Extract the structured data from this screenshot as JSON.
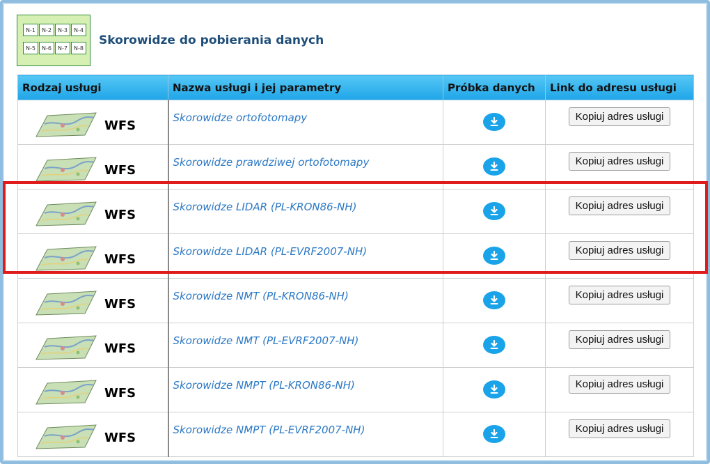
{
  "header": {
    "title": "Skorowidze do pobierania danych",
    "icon_cells": [
      "N-1",
      "N-2",
      "N-3",
      "N-4",
      "N-5",
      "N-6",
      "N-7",
      "N-8"
    ]
  },
  "table": {
    "columns": [
      "Rodzaj usługi",
      "Nazwa usługi i jej parametry",
      "Próbka danych",
      "Link do adresu usługi"
    ],
    "rows": [
      {
        "type": "WFS",
        "name": "Skorowidze ortofotomapy",
        "copy": "Kopiuj adres usługi"
      },
      {
        "type": "WFS",
        "name": "Skorowidze prawdziwej ortofotomapy",
        "copy": "Kopiuj adres usługi"
      },
      {
        "type": "WFS",
        "name": "Skorowidze LIDAR (PL-KRON86-NH)",
        "copy": "Kopiuj adres usługi"
      },
      {
        "type": "WFS",
        "name": "Skorowidze LIDAR (PL-EVRF2007-NH)",
        "copy": "Kopiuj adres usługi"
      },
      {
        "type": "WFS",
        "name": "Skorowidze NMT (PL-KRON86-NH)",
        "copy": "Kopiuj adres usługi"
      },
      {
        "type": "WFS",
        "name": "Skorowidze NMT (PL-EVRF2007-NH)",
        "copy": "Kopiuj adres usługi"
      },
      {
        "type": "WFS",
        "name": "Skorowidze NMPT (PL-KRON86-NH)",
        "copy": "Kopiuj adres usługi"
      },
      {
        "type": "WFS",
        "name": "Skorowidze NMPT (PL-EVRF2007-NH)",
        "copy": "Kopiuj adres usługi"
      }
    ]
  },
  "colors": {
    "header_gradient_top": "#55c7f5",
    "header_gradient_bottom": "#1fa5e8",
    "link": "#2b78c4",
    "download_icon": "#1aa3e8",
    "highlight": "#e01b1b"
  },
  "icons": {
    "type_thumbnail": "map-thumbnail-icon",
    "download": "download-icon"
  }
}
